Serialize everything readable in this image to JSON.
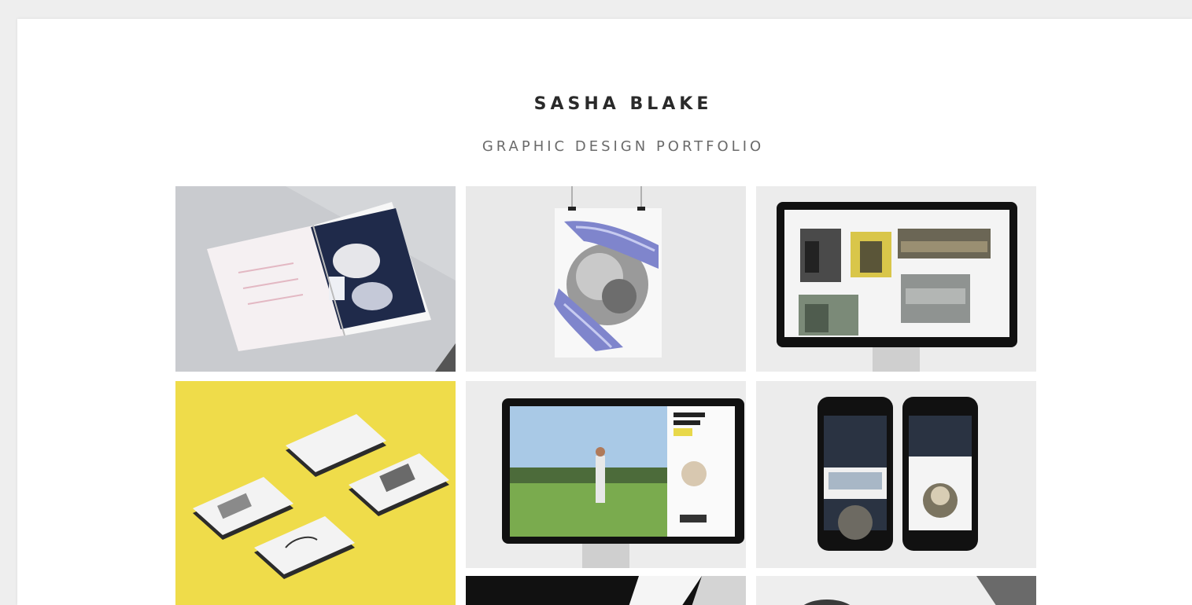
{
  "header": {
    "title": "SASHA BLAKE",
    "subtitle": "GRAPHIC DESIGN PORTFOLIO"
  },
  "portfolio": {
    "items": [
      {
        "icon": "open-book-mockup"
      },
      {
        "icon": "hanging-poster-mockup"
      },
      {
        "icon": "desktop-monitor-gallery-mockup"
      },
      {
        "icon": "business-cards-mockup"
      },
      {
        "icon": "desktop-monitor-website-mockup"
      },
      {
        "icon": "two-phones-mockup"
      },
      {
        "icon": "dark-photo"
      },
      {
        "icon": "light-photo"
      }
    ]
  },
  "colors": {
    "background": "#eeeeee",
    "card": "#ffffff",
    "title": "#2a2a2a",
    "subtitle": "#6a6a6a",
    "yellow_accent": "#efdc4a"
  }
}
